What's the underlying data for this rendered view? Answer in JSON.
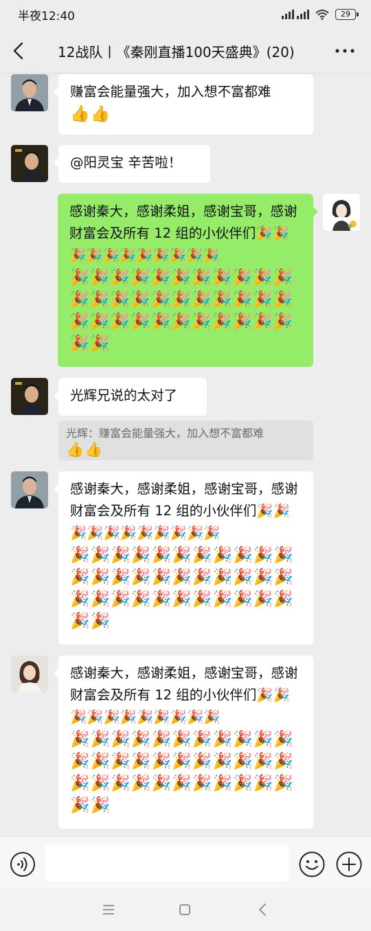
{
  "status": {
    "time": "半夜12:40",
    "battery": "29"
  },
  "header": {
    "title": "12战队丨《秦刚直播100天盛典》(20)"
  },
  "messages": [
    {
      "text": "赚富会能量强大，加入想不富都难",
      "emoji": "👍👍"
    },
    {
      "text": "@阳灵宝  辛苦啦！"
    },
    {
      "text": "感谢秦大，感谢柔姐，感谢宝哥，感谢财富会及所有 12 组的小伙伴们🎉🎉🎉🎉🎉🎉🎉🎉🎉🎉🎉",
      "emoji": "🎉🎉🎉🎉🎉🎉🎉🎉🎉🎉🎉",
      "emoji2": "🎉🎉🎉🎉🎉🎉🎉🎉🎉🎉🎉",
      "emoji3": "🎉🎉🎉🎉🎉🎉🎉🎉🎉🎉🎉",
      "emoji4": "🎉🎉"
    },
    {
      "text": "光辉兄说的太对了",
      "quote": "光辉：赚富会能量强大，加入想不富都难",
      "quote_emoji": "👍👍"
    },
    {
      "text": "感谢秦大，感谢柔姐，感谢宝哥，感谢财富会及所有 12 组的小伙伴们🎉🎉🎉🎉🎉🎉🎉🎉🎉🎉🎉",
      "emoji": "🎉🎉🎉🎉🎉🎉🎉🎉🎉🎉🎉",
      "emoji2": "🎉🎉🎉🎉🎉🎉🎉🎉🎉🎉🎉",
      "emoji3": "🎉🎉🎉🎉🎉🎉🎉🎉🎉🎉🎉",
      "emoji4": "🎉🎉"
    },
    {
      "text": "感谢秦大，感谢柔姐，感谢宝哥，感谢财富会及所有 12 组的小伙伴们🎉🎉🎉🎉🎉🎉🎉🎉🎉🎉🎉",
      "emoji": "🎉🎉🎉🎉🎉🎉🎉🎉🎉🎉🎉",
      "emoji2": "🎉🎉🎉🎉🎉🎉🎉🎉🎉🎉🎉",
      "emoji3": "🎉🎉🎉🎉🎉🎉🎉🎉🎉🎉🎉",
      "emoji4": "🎉🎉"
    }
  ],
  "colors": {
    "background": "#ededed",
    "bubble_mine": "#95ec69",
    "bubble_other": "#ffffff"
  },
  "icons": [
    "back-arrow-icon",
    "more-icon",
    "voice-icon",
    "emoji-icon",
    "plus-icon",
    "menu-icon",
    "home-icon",
    "nav-back-icon"
  ]
}
